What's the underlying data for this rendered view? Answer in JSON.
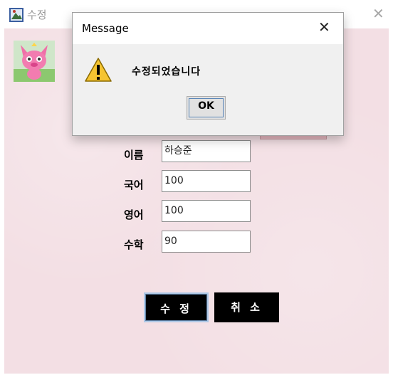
{
  "window": {
    "title": "수정",
    "close_glyph": "✕"
  },
  "form": {
    "rows": [
      {
        "label": "이름",
        "value": "하승준"
      },
      {
        "label": "국어",
        "value": "100"
      },
      {
        "label": "영어",
        "value": "100"
      },
      {
        "label": "수학",
        "value": "90"
      }
    ],
    "edit_label": "수 정",
    "cancel_label": "취 소"
  },
  "dialog": {
    "title": "Message",
    "close_glyph": "✕",
    "message": "수정되었습니다",
    "ok_label": "OK",
    "icon": "warning-icon"
  },
  "colors": {
    "background": "#f3dfe4",
    "button": "#000000",
    "pink_button": "#e8b9c2"
  }
}
